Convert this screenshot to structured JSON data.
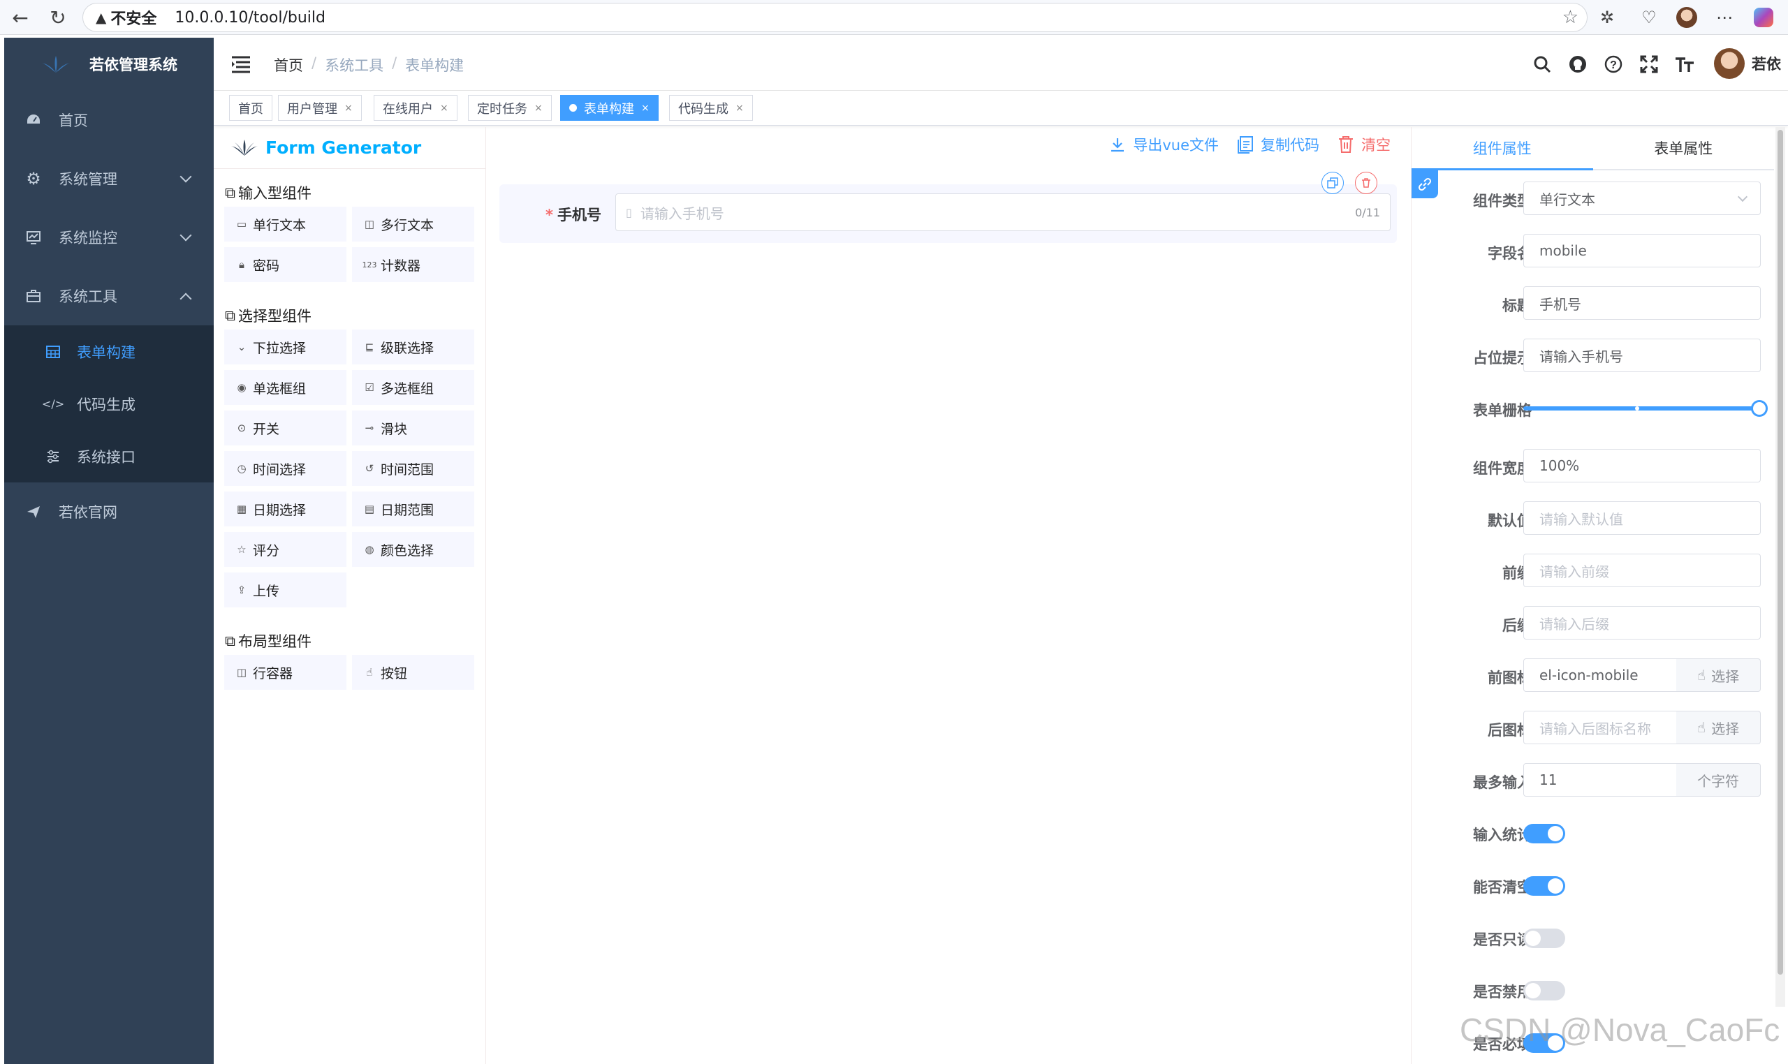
{
  "browser": {
    "security_label": "不安全",
    "url": "10.0.0.10/tool/build"
  },
  "sidebar": {
    "logo_text": "若依管理系统",
    "items": [
      {
        "label": "首页",
        "icon": "dashboard-icon"
      },
      {
        "label": "系统管理",
        "icon": "gear-icon"
      },
      {
        "label": "系统监控",
        "icon": "monitor-icon"
      },
      {
        "label": "系统工具",
        "icon": "toolbox-icon"
      }
    ],
    "submenu": [
      {
        "label": "表单构建",
        "icon": "table-icon",
        "active": true
      },
      {
        "label": "代码生成",
        "icon": "code-icon"
      },
      {
        "label": "系统接口",
        "icon": "sliders-icon"
      }
    ],
    "external": {
      "label": "若依官网",
      "icon": "paper-plane-icon"
    }
  },
  "navbar": {
    "breadcrumb": [
      "首页",
      "系统工具",
      "表单构建"
    ],
    "username": "若依"
  },
  "tags": [
    {
      "label": "首页",
      "closable": false
    },
    {
      "label": "用户管理",
      "closable": true
    },
    {
      "label": "在线用户",
      "closable": true
    },
    {
      "label": "定时任务",
      "closable": true
    },
    {
      "label": "表单构建",
      "closable": true,
      "active": true
    },
    {
      "label": "代码生成",
      "closable": true
    }
  ],
  "generator": {
    "title": "Form Generator",
    "groups": [
      {
        "title": "输入型组件",
        "items": [
          {
            "label": "单行文本",
            "icon": "input-icon"
          },
          {
            "label": "多行文本",
            "icon": "textarea-icon"
          },
          {
            "label": "密码",
            "icon": "lock-icon"
          },
          {
            "label": "计数器",
            "icon": "number-icon"
          }
        ]
      },
      {
        "title": "选择型组件",
        "items": [
          {
            "label": "下拉选择",
            "icon": "select-icon"
          },
          {
            "label": "级联选择",
            "icon": "cascader-icon"
          },
          {
            "label": "单选框组",
            "icon": "radio-icon"
          },
          {
            "label": "多选框组",
            "icon": "checkbox-icon"
          },
          {
            "label": "开关",
            "icon": "switch-icon"
          },
          {
            "label": "滑块",
            "icon": "slider-icon"
          },
          {
            "label": "时间选择",
            "icon": "clock-icon"
          },
          {
            "label": "时间范围",
            "icon": "time-range-icon"
          },
          {
            "label": "日期选择",
            "icon": "calendar-icon"
          },
          {
            "label": "日期范围",
            "icon": "date-range-icon"
          },
          {
            "label": "评分",
            "icon": "star-icon"
          },
          {
            "label": "颜色选择",
            "icon": "palette-icon"
          },
          {
            "label": "上传",
            "icon": "upload-icon"
          }
        ]
      },
      {
        "title": "布局型组件",
        "items": [
          {
            "label": "行容器",
            "icon": "row-icon"
          },
          {
            "label": "按钮",
            "icon": "hand-pointer-icon"
          }
        ]
      }
    ]
  },
  "actions": {
    "export": "导出vue文件",
    "copy": "复制代码",
    "clear": "清空"
  },
  "canvas": {
    "field_label": "手机号",
    "required_mark": "*",
    "placeholder": "请输入手机号",
    "count": "0/11"
  },
  "props_panel": {
    "tabs": [
      "组件属性",
      "表单属性"
    ],
    "rows": [
      {
        "label": "组件类型",
        "value": "单行文本",
        "kind": "select"
      },
      {
        "label": "字段名",
        "value": "mobile",
        "kind": "input"
      },
      {
        "label": "标题",
        "value": "手机号",
        "kind": "input"
      },
      {
        "label": "占位提示",
        "value": "请输入手机号",
        "kind": "input"
      },
      {
        "label": "表单栅格",
        "value": 24,
        "kind": "slider"
      },
      {
        "label": "组件宽度",
        "value": "100%",
        "kind": "input"
      },
      {
        "label": "默认值",
        "placeholder": "请输入默认值",
        "kind": "input"
      },
      {
        "label": "前缀",
        "placeholder": "请输入前缀",
        "kind": "input"
      },
      {
        "label": "后缀",
        "placeholder": "请输入后缀",
        "kind": "input"
      },
      {
        "label": "前图标",
        "value": "el-icon-mobile",
        "kind": "input-btn",
        "btn": "选择"
      },
      {
        "label": "后图标",
        "placeholder": "请输入后图标名称",
        "kind": "input-btn",
        "btn": "选择"
      },
      {
        "label": "最多输入",
        "value": "11",
        "kind": "input-append",
        "append": "个字符"
      },
      {
        "label": "输入统计",
        "kind": "switch",
        "on": true
      },
      {
        "label": "能否清空",
        "kind": "switch",
        "on": true
      },
      {
        "label": "是否只读",
        "kind": "switch",
        "on": false
      },
      {
        "label": "是否禁用",
        "kind": "switch",
        "on": false
      },
      {
        "label": "是否必填",
        "kind": "switch",
        "on": true
      }
    ]
  },
  "watermark": "CSDN @Nova_CaoFc",
  "colors": {
    "sidebar_bg": "#304156",
    "submenu_bg": "#1f2d3d",
    "accent": "#409eff",
    "danger": "#f56c6c",
    "title": "#00afff"
  }
}
